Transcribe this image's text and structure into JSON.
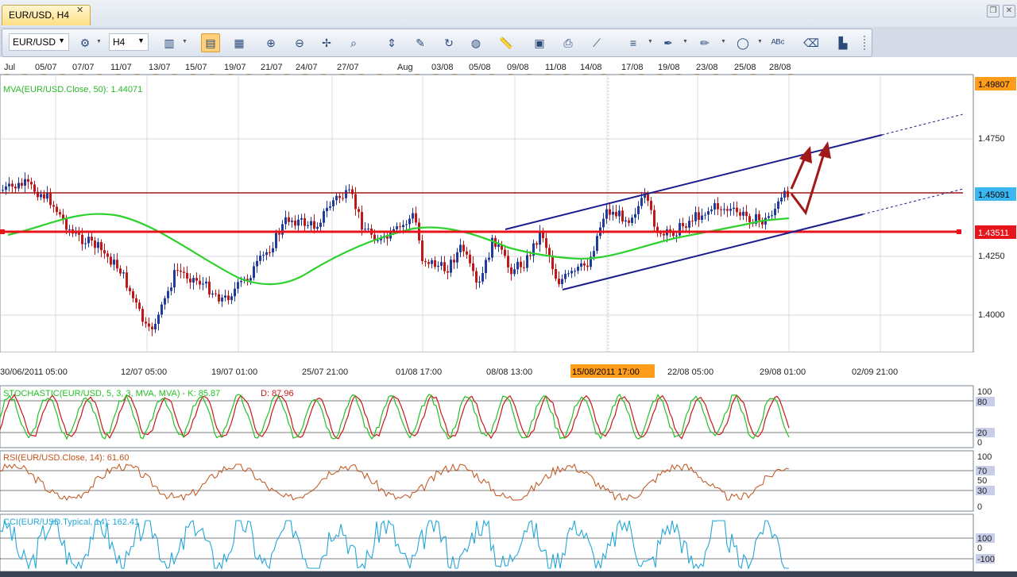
{
  "tab": {
    "title": "EUR/USD, H4",
    "close": "✕"
  },
  "window": {
    "restore": "❐",
    "close": "✕"
  },
  "toolbar": {
    "symbol": "EUR/USD",
    "timeframe": "H4",
    "icons": [
      "symbol-settings-icon",
      "bar-chart-icon",
      "candlestick-chart-icon",
      "line-chart-icon",
      "zoom-in-icon",
      "zoom-out-icon",
      "crosshair-icon",
      "search-icon",
      "vertical-line-icon",
      "draw-icon",
      "refresh-icon",
      "globe-icon",
      "ruler-icon",
      "image-icon",
      "print-icon",
      "trend-line-icon",
      "channel-icon",
      "pen-icon",
      "brush-icon",
      "ellipse-icon",
      "text-icon",
      "eraser-icon",
      "indicators-icon"
    ]
  },
  "top_axis": [
    "Jul",
    "05/07",
    "07/07",
    "11/07",
    "13/07",
    "15/07",
    "19/07",
    "21/07",
    "24/07",
    "27/07",
    "Aug",
    "03/08",
    "05/08",
    "09/08",
    "11/08",
    "14/08",
    "17/08",
    "19/08",
    "23/08",
    "25/08",
    "28/08"
  ],
  "price_panel": {
    "indicator_label": "MVA(EUR/USD.Close, 50): 1.44071",
    "price_ticks": [
      "1.4750",
      "1.4250",
      "1.4000"
    ],
    "price_badges": {
      "high": "1.49807",
      "current": "1.45091",
      "level": "1.43511"
    },
    "colors": {
      "high_badge": "#ff9c1a",
      "current_badge": "#3ab7f0",
      "level_badge": "#e8141b",
      "ma": "#2ed12e",
      "channel": "#1c1c8c",
      "resistance": "#a01818"
    }
  },
  "bottom_axis": {
    "labels": [
      "30/06/2011 05:00",
      "12/07 05:00",
      "19/07 01:00",
      "25/07 21:00",
      "01/08 17:00",
      "08/08 13:00",
      "22/08 05:00",
      "29/08 01:00",
      "02/09 21:00"
    ],
    "highlight": "15/08/2011 17:00"
  },
  "stochastic": {
    "label": "STOCHASTIC(EUR/USD, 5, 3, 3, MVA, MVA) -  K: 85.87",
    "label_d": "D: 87.96",
    "ticks": [
      "100",
      "80",
      "20",
      "0"
    ]
  },
  "rsi": {
    "label": "RSI(EUR/USD.Close, 14): 61.60",
    "ticks": [
      "100",
      "70",
      "50",
      "30",
      "0"
    ]
  },
  "cci": {
    "label": "CCI(EUR/USD.Typical, 14): 162.41",
    "ticks": [
      "100",
      "0",
      "-100"
    ]
  }
}
